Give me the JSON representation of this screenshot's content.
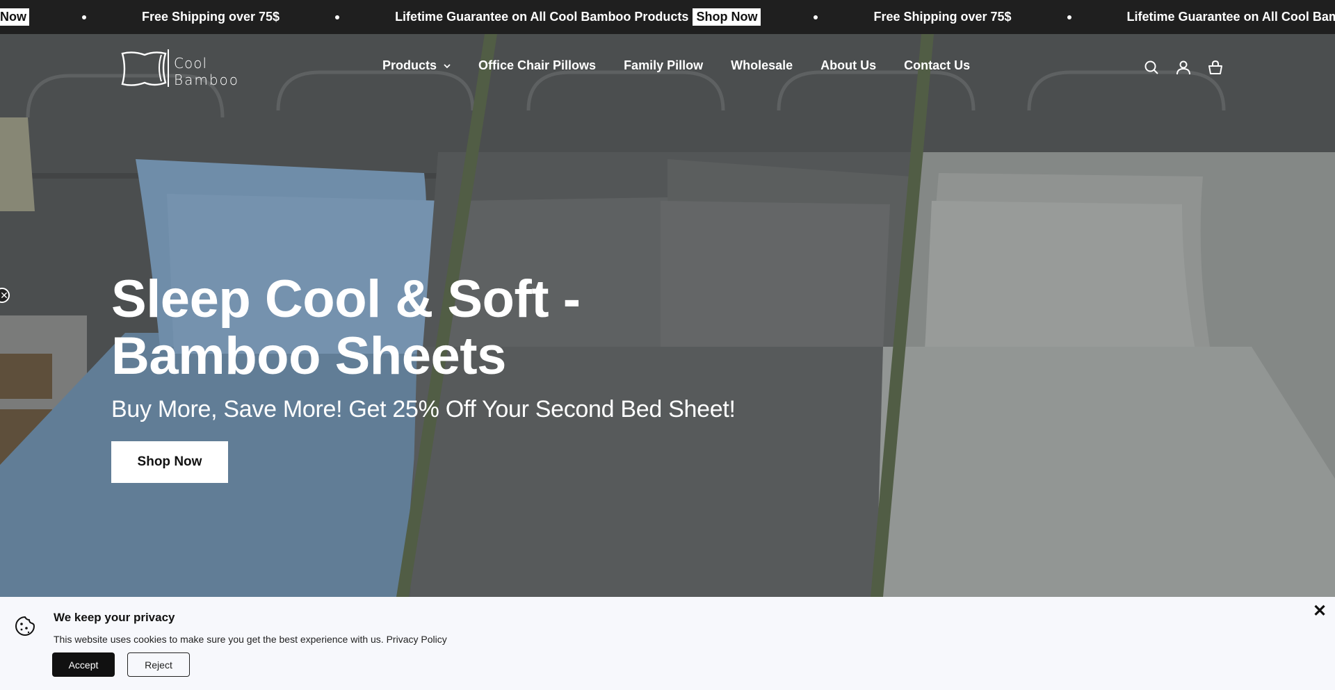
{
  "announcement": {
    "items": [
      {
        "text": "Now",
        "cta": ""
      },
      {
        "text": "Free Shipping over 75$",
        "cta": ""
      },
      {
        "text": "Lifetime Guarantee on All Cool Bamboo Products",
        "cta": "Shop Now"
      },
      {
        "text": "Free Shipping over 75$",
        "cta": ""
      },
      {
        "text": "Lifetime Guarantee on All Cool Bamboo Products",
        "cta": ""
      }
    ]
  },
  "header": {
    "logo_line1": "Cool",
    "logo_line2": "Bamboo",
    "nav": [
      {
        "label": "Products",
        "has_dropdown": true
      },
      {
        "label": "Office Chair Pillows"
      },
      {
        "label": "Family Pillow"
      },
      {
        "label": "Wholesale"
      },
      {
        "label": "About Us"
      },
      {
        "label": "Contact Us"
      }
    ],
    "icons": [
      "search-icon",
      "account-icon",
      "cart-icon"
    ]
  },
  "hero": {
    "title": "Sleep Cool & Soft - Bamboo Sheets",
    "subtitle": "Buy More, Save More! Get 25% Off Your Second Bed Sheet!",
    "cta": "Shop Now",
    "colors": {
      "blue": "#7f9fbe",
      "gray": "#6a6d6e",
      "light": "#a2a6a4",
      "stripe": "#5d6a4f"
    }
  },
  "cookie": {
    "title": "We keep your privacy",
    "text": "This website uses cookies to make sure you get the best experience with us.",
    "link": "Privacy Policy",
    "accept": "Accept",
    "reject": "Reject"
  }
}
